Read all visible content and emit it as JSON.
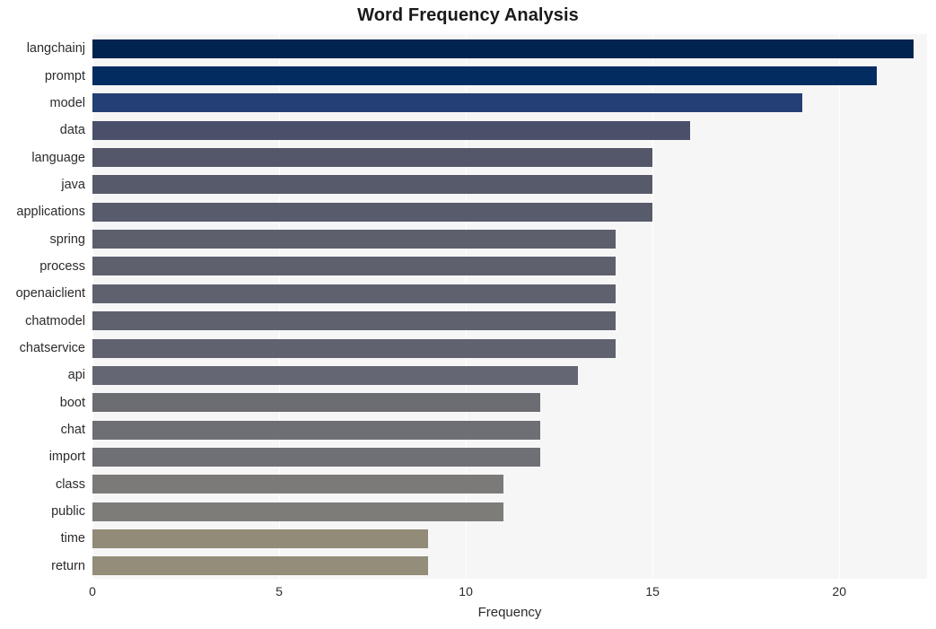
{
  "chart_data": {
    "type": "bar",
    "orientation": "horizontal",
    "title": "Word Frequency Analysis",
    "xlabel": "Frequency",
    "ylabel": "",
    "categories": [
      "langchainj",
      "prompt",
      "model",
      "data",
      "language",
      "java",
      "applications",
      "spring",
      "process",
      "openaiclient",
      "chatmodel",
      "chatservice",
      "api",
      "boot",
      "chat",
      "import",
      "class",
      "public",
      "time",
      "return"
    ],
    "values": [
      22,
      21,
      19,
      16,
      15,
      15,
      15,
      14,
      14,
      14,
      14,
      14,
      13,
      12,
      12,
      12,
      11,
      11,
      9,
      9
    ],
    "bar_colors": [
      "#01234f",
      "#032c61",
      "#243f73",
      "#4a5069",
      "#545769",
      "#575a6a",
      "#585b6b",
      "#5d5f6d",
      "#5e606e",
      "#5f616f",
      "#5f616f",
      "#606270",
      "#646673",
      "#6c6d73",
      "#6e6f74",
      "#6f7075",
      "#7b7a78",
      "#7d7c79",
      "#918b77",
      "#938d79"
    ],
    "xlim": [
      0,
      22.35
    ],
    "xticks": [
      0,
      5,
      10,
      15,
      20
    ],
    "xtick_labels": [
      "0",
      "5",
      "10",
      "15",
      "20"
    ],
    "grid": "vertical-white",
    "legend": "none",
    "plot_background": "#f6f6f7",
    "figure_background": "#ffffff"
  }
}
